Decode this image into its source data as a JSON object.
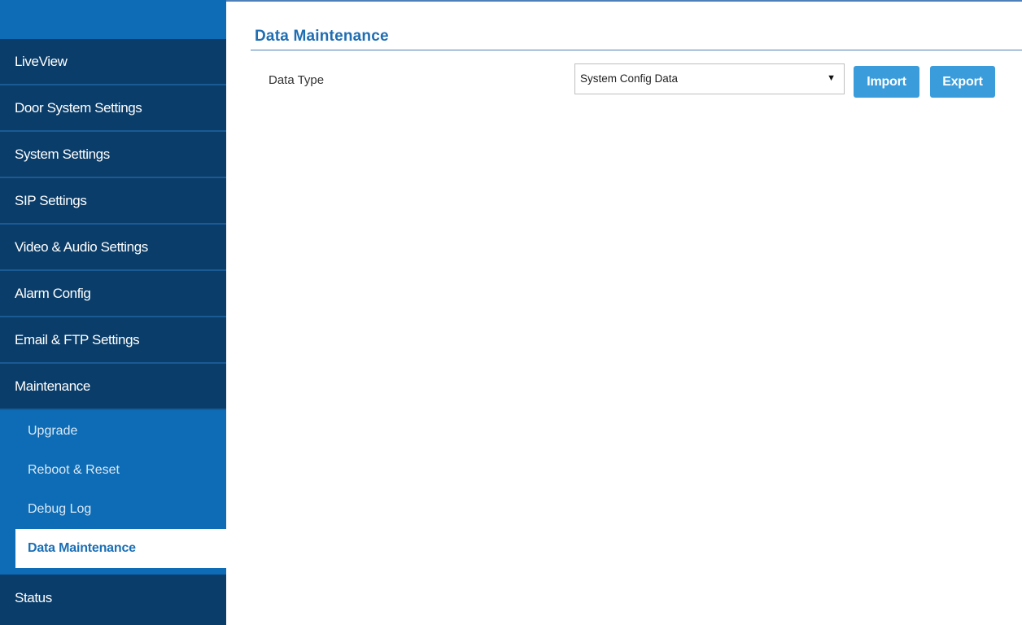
{
  "sidebar": {
    "menu_top": [
      {
        "label": "LiveView"
      },
      {
        "label": "Door System Settings"
      },
      {
        "label": "System Settings"
      },
      {
        "label": "SIP Settings"
      },
      {
        "label": "Video & Audio Settings"
      },
      {
        "label": "Alarm Config"
      },
      {
        "label": "Email & FTP Settings"
      },
      {
        "label": "Maintenance"
      }
    ],
    "submenu": [
      {
        "label": "Upgrade"
      },
      {
        "label": "Reboot & Reset"
      },
      {
        "label": "Debug Log"
      },
      {
        "label": "Data Maintenance",
        "active": true
      }
    ],
    "menu_bottom": [
      {
        "label": "Status"
      }
    ]
  },
  "main": {
    "title": "Data Maintenance",
    "data_type_label": "Data Type",
    "data_type_selected": "System Config Data",
    "import_label": "Import",
    "export_label": "Export"
  },
  "colors": {
    "menu_bg": "#0a3d69",
    "submenu_bg": "#0d6cb5",
    "accent": "#1f6db2",
    "button_bg": "#3a9cdb"
  }
}
